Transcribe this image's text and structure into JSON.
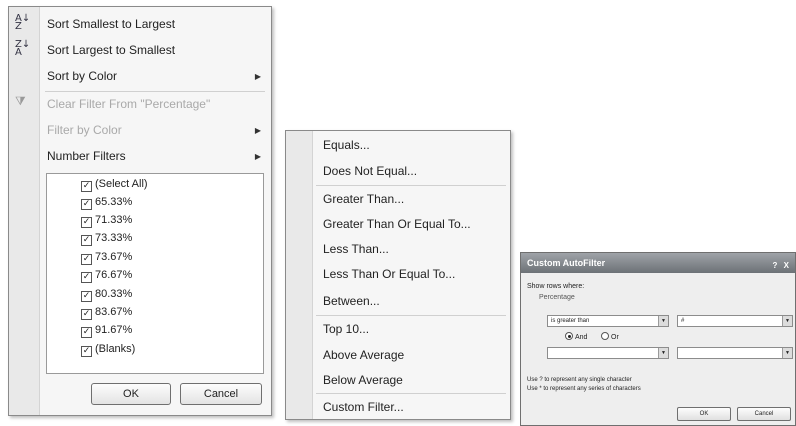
{
  "filter_menu": {
    "sort_items": [
      {
        "label": "Sort Smallest to Largest",
        "icon": "sort-ascending-icon"
      },
      {
        "label": "Sort Largest to Smallest",
        "icon": "sort-descending-icon"
      }
    ],
    "sort_by_color": "Sort by Color",
    "clear_filter": "Clear Filter From \"Percentage\"",
    "filter_by_color": "Filter by Color",
    "number_filters": "Number Filters",
    "arrow": "▶",
    "values": [
      {
        "label": "(Select All)",
        "checked": true
      },
      {
        "label": "65.33%",
        "checked": true
      },
      {
        "label": "71.33%",
        "checked": true
      },
      {
        "label": "73.33%",
        "checked": true
      },
      {
        "label": "73.67%",
        "checked": true
      },
      {
        "label": "76.67%",
        "checked": true
      },
      {
        "label": "80.33%",
        "checked": true
      },
      {
        "label": "83.67%",
        "checked": true
      },
      {
        "label": "91.67%",
        "checked": true
      },
      {
        "label": "(Blanks)",
        "checked": true
      }
    ],
    "ok_label": "OK",
    "cancel_label": "Cancel"
  },
  "number_filters_menu": {
    "groups": [
      [
        "Equals...",
        "Does Not Equal..."
      ],
      [
        "Greater Than...",
        "Greater Than Or Equal To...",
        "Less Than...",
        "Less Than Or Equal To...",
        "Between..."
      ],
      [
        "Top 10...",
        "Above Average",
        "Below Average"
      ],
      [
        "Custom Filter..."
      ]
    ]
  },
  "custom_autofilter": {
    "title": "Custom AutoFilter",
    "title_buttons": "? X",
    "show_rows_label": "Show rows where:",
    "field_label": "Percentage",
    "condition1_operator": "is greater than",
    "condition1_value": "#",
    "and_label": "And",
    "or_label": "Or",
    "and_selected": true,
    "condition2_operator": "",
    "condition2_value": "",
    "hint1": "Use ? to represent any single character",
    "hint2": "Use * to represent any series of characters",
    "ok_label": "OK",
    "cancel_label": "Cancel",
    "dropdown_glyph": "▼"
  }
}
